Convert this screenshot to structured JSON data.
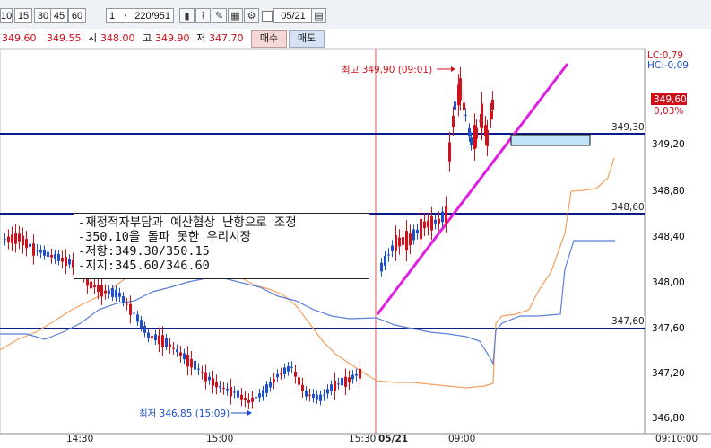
{
  "toolbar": {
    "periods": [
      "10",
      "15",
      "30",
      "45",
      "60"
    ],
    "interval_value": "1",
    "count_value": "220/951",
    "date_value": "05/21",
    "icons": [
      "candle-icon",
      "indicator-icon",
      "draw-icon",
      "grid-icon",
      "settings-icon"
    ]
  },
  "price_bar": {
    "current": "349.60",
    "change": "349.55",
    "open_label": "시",
    "open": "348.00",
    "high_label": "고",
    "high": "349.90",
    "low_label": "저",
    "low": "347.70",
    "buy_label": "매수",
    "sell_label": "매도"
  },
  "chart": {
    "y_ticks": [
      "349,20",
      "348,80",
      "348,40",
      "348,00",
      "347,60",
      "347,20",
      "346,80"
    ],
    "x_ticks": [
      "14:30",
      "15:00",
      "15:30",
      "05/21",
      "09:00",
      "09:10:00"
    ],
    "lc_label": "LC:0,79",
    "hc_label": "HC:-0,09",
    "last_price": "349,60",
    "last_pct": "0,03%",
    "high_marker": "최고 349,90 (09:01)",
    "low_marker": "최저 346,85 (15:09)",
    "hline_labels": [
      "349,30",
      "348,60",
      "347,60"
    ],
    "colors": {
      "up": "#d0101a",
      "down": "#1f4fd1",
      "hline": "#0a1a8c",
      "trend": "#e01de0",
      "orange": "#f2a060",
      "blue_line": "#5a7fd6"
    }
  },
  "note": {
    "lines": [
      "-재정적자부담과 예산협상 난항으로 조정",
      "-350.10을 돌파 못한 우리시장",
      "-저항:349.30/350.15",
      "-지지:345.60/346.60"
    ]
  }
}
